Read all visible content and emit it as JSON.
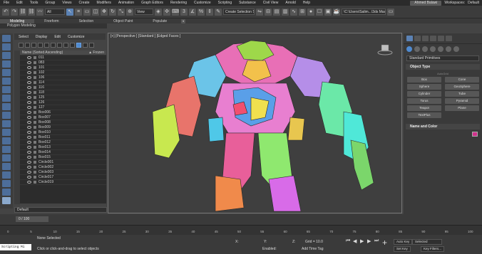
{
  "menu": {
    "items": [
      "File",
      "Edit",
      "Tools",
      "Group",
      "Views",
      "Create",
      "Modifiers",
      "Animation",
      "Graph Editors",
      "Rendering",
      "Customize",
      "Scripting",
      "Substance",
      "Civil View",
      "Arnold",
      "Help"
    ],
    "user": "Ahmed Balawi",
    "workspaces_label": "Workspaces:",
    "workspace_value": "Default"
  },
  "toolbar": {
    "filter_value": "All",
    "view_value": "View",
    "selection_set_value": "Create Selection Se",
    "project_path": "\\C:\\Users\\Salim...\\3ds Max 2022"
  },
  "ribbon": {
    "tabs": [
      "Modeling",
      "Freeform",
      "Selection",
      "Object Paint",
      "Populate"
    ],
    "sub_label": "Polygon Modeling"
  },
  "scene_explorer": {
    "menu": [
      "Select",
      "Display",
      "Edit",
      "Customize"
    ],
    "col_name": "Name (Sorted Ascending)",
    "col_frozen": "▲ Frozen",
    "rows": [
      "011",
      "083",
      "101",
      "102",
      "106",
      "114",
      "116",
      "118",
      "125",
      "126",
      "127",
      "Box006",
      "Box007",
      "Box008",
      "Box009",
      "Box010",
      "Box011",
      "Box012",
      "Box013",
      "Box014",
      "Box015",
      "Circle001",
      "Circle002",
      "Circle003",
      "Circle017",
      "Circle019"
    ],
    "layer_value": "Default"
  },
  "viewport": {
    "label": "[+] [Perspective ] [Standard ] [Edged Faces ]"
  },
  "command_panel": {
    "category_value": "Standard Primitives",
    "object_type_title": "Object Type",
    "autogrid_label": "AutoGrid",
    "objects": [
      "Box",
      "Cone",
      "Sphere",
      "GeoSphere",
      "Cylinder",
      "Tube",
      "Torus",
      "Pyramid",
      "Teapot",
      "Plane",
      "TextPlus"
    ],
    "name_color_title": "Name and Color",
    "object_color": "#d0318c"
  },
  "timeline": {
    "frame_display": "0 / 100",
    "ticks": [
      "0",
      "5",
      "10",
      "15",
      "20",
      "25",
      "30",
      "35",
      "40",
      "45",
      "50",
      "55",
      "60",
      "65",
      "70",
      "75",
      "80",
      "85",
      "90",
      "95",
      "100"
    ]
  },
  "status": {
    "maxscript_label": "Scripting Mi",
    "none_selected": "None Selected",
    "prompt": "Click or click-and-drag to select objects",
    "x_label": "X:",
    "y_label": "Y:",
    "z_label": "Z:",
    "grid_label": "Grid = 10.0",
    "add_time_tag": "Add Time Tag",
    "enabled_label": "Enabled:",
    "auto_key": "Auto Key",
    "set_key": "Set Key",
    "selected_value": "Selected",
    "key_filters": "Key Filters..."
  },
  "colors": {
    "accent": "#5b82b5",
    "viewport_bg": "#3f3f3f",
    "panel_bg": "#3a3a3a"
  }
}
